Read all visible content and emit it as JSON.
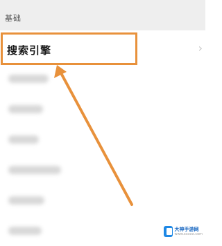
{
  "section": {
    "title": "基础"
  },
  "menu": {
    "items": [
      {
        "label": "搜索引擎",
        "chevron": "›"
      }
    ]
  },
  "watermark": {
    "name": "大神手游网",
    "url": "www.xxxxx.com"
  },
  "colors": {
    "highlight": "#e8913b",
    "section_bg": "#eeeeee",
    "watermark_blue": "#1e88e5"
  }
}
